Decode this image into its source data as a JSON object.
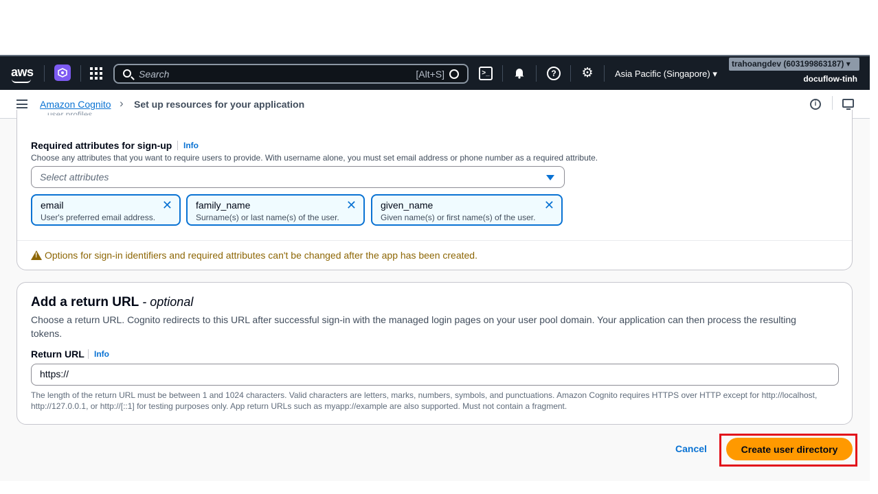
{
  "nav": {
    "logo": "aws",
    "search_placeholder": "Search",
    "search_shortcut": "[Alt+S]",
    "region": "Asia Pacific (Singapore) ▾",
    "account": "trahoangdev (603199863187) ▾",
    "profile": "docuflow-tinh"
  },
  "breadcrumb": {
    "link": "Amazon Cognito",
    "separator": "›",
    "current": "Set up resources for your application"
  },
  "cut_text": "user profiles.",
  "required_attributes": {
    "label": "Required attributes for sign-up",
    "info": "Info",
    "description": "Choose any attributes that you want to require users to provide. With username alone, you must set email address or phone number as a required attribute.",
    "select_placeholder": "Select attributes",
    "tokens": [
      {
        "name": "email",
        "description": "User's preferred email address."
      },
      {
        "name": "family_name",
        "description": "Surname(s) or last name(s) of the user."
      },
      {
        "name": "given_name",
        "description": "Given name(s) or first name(s) of the user."
      }
    ],
    "warning": "Options for sign-in identifiers and required attributes can't be changed after the app has been created."
  },
  "return_url": {
    "heading": "Add a return URL",
    "heading_optional": " - optional",
    "description": "Choose a return URL. Cognito redirects to this URL after successful sign-in with the managed login pages on your user pool domain. Your application can then process the resulting tokens.",
    "label": "Return URL",
    "info": "Info",
    "value": "https://",
    "hint": "The length of the return URL must be between 1 and 1024 characters. Valid characters are letters, marks, numbers, symbols, and punctuations. Amazon Cognito requires HTTPS over HTTP except for http://localhost, http://127.0.0.1, or http://[::1] for testing purposes only. App return URLs such as myapp://example are also supported. Must not contain a fragment."
  },
  "actions": {
    "cancel": "Cancel",
    "create": "Create user directory"
  },
  "colors": {
    "accent": "#0972d3",
    "primary_button": "#ff9900",
    "nav_background": "#161d26",
    "warning": "#8d6605",
    "highlight_box": "#e2121b"
  },
  "icons": {
    "menu": "hamburger-icon",
    "info": "info-circle-icon",
    "monitor": "monitor-icon",
    "search": "search-icon",
    "bell": "bell-icon",
    "help": "help-icon",
    "settings": "gear-icon",
    "terminal": "cloudshell-icon",
    "apps": "grid-icon",
    "warning": "warning-icon",
    "remove": "close-icon"
  }
}
